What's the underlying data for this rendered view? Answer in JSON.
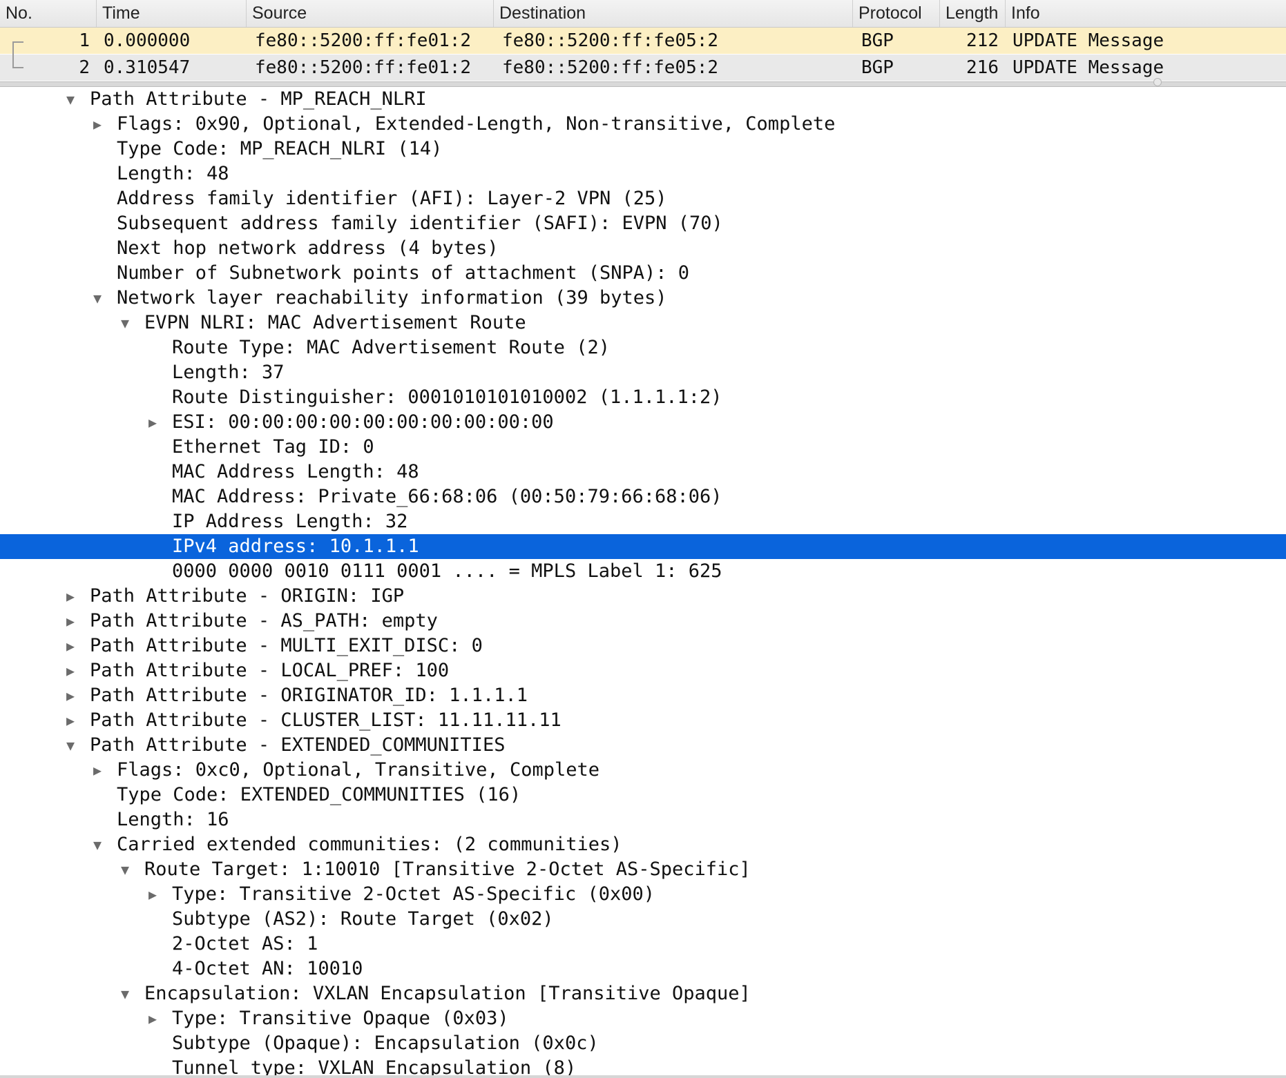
{
  "columns": {
    "no": "No.",
    "time": "Time",
    "source": "Source",
    "destination": "Destination",
    "protocol": "Protocol",
    "length": "Length",
    "info": "Info"
  },
  "packets": [
    {
      "no": "1",
      "time": "0.000000",
      "source": "fe80::5200:ff:fe01:2",
      "destination": "fe80::5200:ff:fe05:2",
      "protocol": "BGP",
      "length": "212",
      "info": "UPDATE Message"
    },
    {
      "no": "2",
      "time": "0.310547",
      "source": "fe80::5200:ff:fe01:2",
      "destination": "fe80::5200:ff:fe05:2",
      "protocol": "BGP",
      "length": "216",
      "info": "UPDATE Message"
    }
  ],
  "tree": [
    {
      "text": "Path Attribute - MP_REACH_NLRI",
      "level": 0,
      "toggle": "expanded"
    },
    {
      "text": "Flags: 0x90, Optional, Extended-Length, Non-transitive, Complete",
      "level": 1,
      "toggle": "collapsed"
    },
    {
      "text": "Type Code: MP_REACH_NLRI (14)",
      "level": 1,
      "toggle": "none"
    },
    {
      "text": "Length: 48",
      "level": 1,
      "toggle": "none"
    },
    {
      "text": "Address family identifier (AFI): Layer-2 VPN (25)",
      "level": 1,
      "toggle": "none"
    },
    {
      "text": "Subsequent address family identifier (SAFI): EVPN (70)",
      "level": 1,
      "toggle": "none"
    },
    {
      "text": "Next hop network address (4 bytes)",
      "level": 1,
      "toggle": "none"
    },
    {
      "text": "Number of Subnetwork points of attachment (SNPA): 0",
      "level": 1,
      "toggle": "none"
    },
    {
      "text": "Network layer reachability information (39 bytes)",
      "level": 1,
      "toggle": "expanded"
    },
    {
      "text": "EVPN NLRI: MAC Advertisement Route",
      "level": 2,
      "toggle": "expanded"
    },
    {
      "text": "Route Type: MAC Advertisement Route (2)",
      "level": 3,
      "toggle": "none"
    },
    {
      "text": "Length: 37",
      "level": 3,
      "toggle": "none"
    },
    {
      "text": "Route Distinguisher: 0001010101010002 (1.1.1.1:2)",
      "level": 3,
      "toggle": "none"
    },
    {
      "text": "ESI: 00:00:00:00:00:00:00:00:00:00",
      "level": 3,
      "toggle": "collapsed"
    },
    {
      "text": "Ethernet Tag ID: 0",
      "level": 3,
      "toggle": "none"
    },
    {
      "text": "MAC Address Length: 48",
      "level": 3,
      "toggle": "none"
    },
    {
      "text": "MAC Address: Private_66:68:06 (00:50:79:66:68:06)",
      "level": 3,
      "toggle": "none"
    },
    {
      "text": "IP Address Length: 32",
      "level": 3,
      "toggle": "none"
    },
    {
      "text": "IPv4 address: 10.1.1.1",
      "level": 3,
      "toggle": "none",
      "selected": true
    },
    {
      "text": "0000 0000 0010 0111 0001 .... = MPLS Label 1: 625",
      "level": 3,
      "toggle": "none"
    },
    {
      "text": "Path Attribute - ORIGIN: IGP",
      "level": 0,
      "toggle": "collapsed"
    },
    {
      "text": "Path Attribute - AS_PATH: empty",
      "level": 0,
      "toggle": "collapsed"
    },
    {
      "text": "Path Attribute - MULTI_EXIT_DISC: 0",
      "level": 0,
      "toggle": "collapsed"
    },
    {
      "text": "Path Attribute - LOCAL_PREF: 100",
      "level": 0,
      "toggle": "collapsed"
    },
    {
      "text": "Path Attribute - ORIGINATOR_ID: 1.1.1.1",
      "level": 0,
      "toggle": "collapsed"
    },
    {
      "text": "Path Attribute - CLUSTER_LIST: 11.11.11.11",
      "level": 0,
      "toggle": "collapsed"
    },
    {
      "text": "Path Attribute - EXTENDED_COMMUNITIES",
      "level": 0,
      "toggle": "expanded"
    },
    {
      "text": "Flags: 0xc0, Optional, Transitive, Complete",
      "level": 1,
      "toggle": "collapsed"
    },
    {
      "text": "Type Code: EXTENDED_COMMUNITIES (16)",
      "level": 1,
      "toggle": "none"
    },
    {
      "text": "Length: 16",
      "level": 1,
      "toggle": "none"
    },
    {
      "text": "Carried extended communities: (2 communities)",
      "level": 1,
      "toggle": "expanded"
    },
    {
      "text": "Route Target: 1:10010 [Transitive 2-Octet AS-Specific]",
      "level": 2,
      "toggle": "expanded"
    },
    {
      "text": "Type: Transitive 2-Octet AS-Specific (0x00)",
      "level": 3,
      "toggle": "collapsed"
    },
    {
      "text": "Subtype (AS2): Route Target (0x02)",
      "level": 3,
      "toggle": "none"
    },
    {
      "text": "2-Octet AS: 1",
      "level": 3,
      "toggle": "none"
    },
    {
      "text": "4-Octet AN: 10010",
      "level": 3,
      "toggle": "none"
    },
    {
      "text": "Encapsulation: VXLAN Encapsulation [Transitive Opaque]",
      "level": 2,
      "toggle": "expanded"
    },
    {
      "text": "Type: Transitive Opaque (0x03)",
      "level": 3,
      "toggle": "collapsed"
    },
    {
      "text": "Subtype (Opaque): Encapsulation (0x0c)",
      "level": 3,
      "toggle": "none"
    },
    {
      "text": "Tunnel type: VXLAN Encapsulation (8)",
      "level": 3,
      "toggle": "none"
    }
  ],
  "icons": {
    "expanded": "▼",
    "collapsed": "▶"
  },
  "colors": {
    "selection": "#0a64dc",
    "packet_row_1": "#fcefc4",
    "packet_row_2": "#e9e9e9"
  }
}
